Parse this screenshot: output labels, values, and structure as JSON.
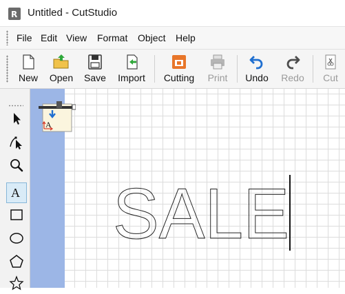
{
  "window": {
    "title": "Untitled - CutStudio"
  },
  "menu": {
    "items": [
      "File",
      "Edit",
      "View",
      "Format",
      "Object",
      "Help"
    ]
  },
  "toolbar": {
    "new": "New",
    "open": "Open",
    "save": "Save",
    "import": "Import",
    "cutting": "Cutting",
    "print": "Print",
    "undo": "Undo",
    "redo": "Redo",
    "cut": "Cut"
  },
  "tools": [
    "select-arrow-icon",
    "node-edit-icon",
    "zoom-icon",
    "text-tool-icon",
    "rectangle-icon",
    "ellipse-icon",
    "pentagon-icon",
    "star-icon"
  ],
  "active_tool": "text-tool-icon",
  "canvas": {
    "text": "SALE",
    "media_color": "#9cb6e6"
  },
  "colors": {
    "accent": "#1f6fd0",
    "orange": "#e8762a",
    "green": "#2fa83a"
  }
}
